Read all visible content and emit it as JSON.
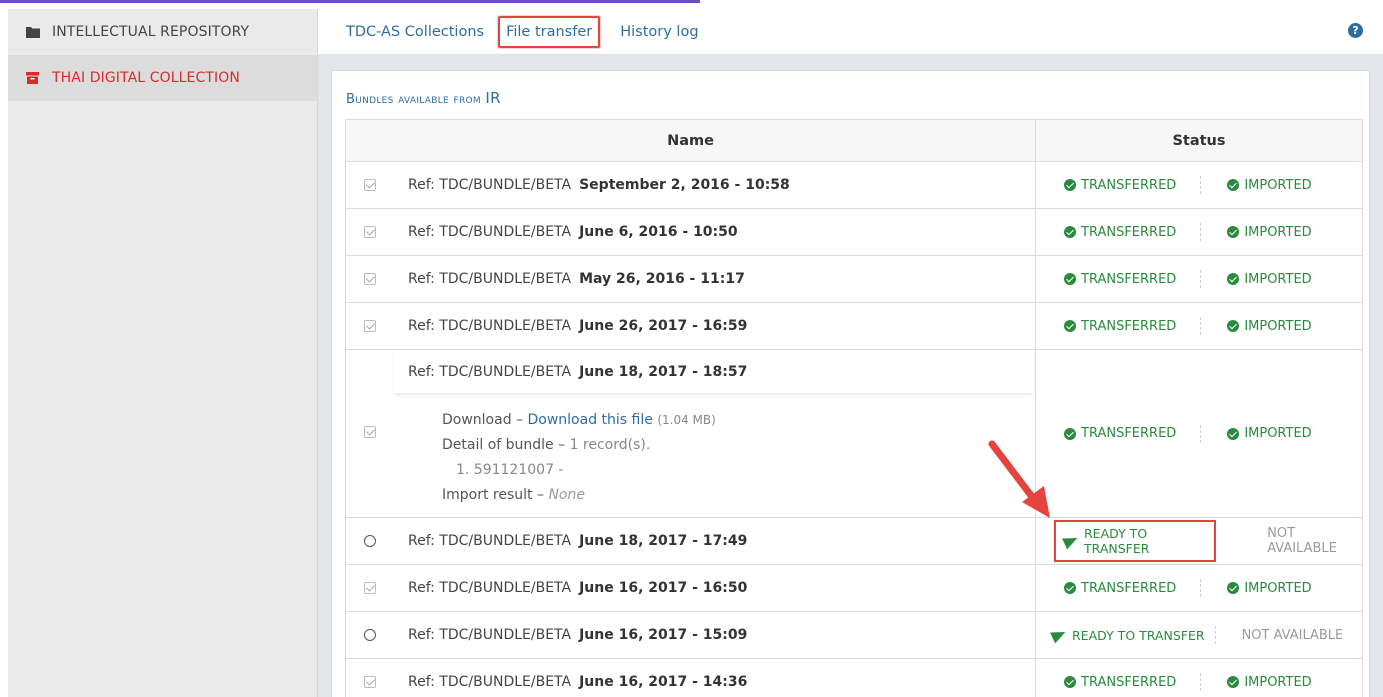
{
  "sidebar": {
    "items": [
      {
        "label": "INTELLECTUAL REPOSITORY",
        "icon": "folder-icon",
        "active": false
      },
      {
        "label": "THAI DIGITAL COLLECTION",
        "icon": "archive-icon",
        "active": true
      }
    ]
  },
  "tabs": [
    {
      "label": "TDC-AS Collections",
      "active": false
    },
    {
      "label": "File transfer",
      "active": true
    },
    {
      "label": "History log",
      "active": false
    }
  ],
  "help_icon": "?",
  "panel": {
    "title_small": "Bundles available from",
    "title_big": "IR"
  },
  "table": {
    "headers": {
      "name": "Name",
      "status": "Status"
    },
    "ref_prefix": "Ref: TDC/BUNDLE/BETA",
    "rows": [
      {
        "selector": "checked",
        "date": "September 2, 2016 - 10:58",
        "status1": "TRANSFERRED",
        "status2": "IMPORTED"
      },
      {
        "selector": "checked",
        "date": "June 6, 2016 - 10:50",
        "status1": "TRANSFERRED",
        "status2": "IMPORTED"
      },
      {
        "selector": "checked",
        "date": "May 26, 2016 - 11:17",
        "status1": "TRANSFERRED",
        "status2": "IMPORTED"
      },
      {
        "selector": "checked",
        "date": "June 26, 2017 - 16:59",
        "status1": "TRANSFERRED",
        "status2": "IMPORTED"
      },
      {
        "selector": "checked",
        "date": "June 18, 2017 - 18:57",
        "status1": "TRANSFERRED",
        "status2": "IMPORTED",
        "expanded": true
      },
      {
        "selector": "radio",
        "date": "June 18, 2017 - 17:49",
        "status1": "READY TO TRANSFER",
        "status2": "NOT AVAILABLE"
      },
      {
        "selector": "checked",
        "date": "June 16, 2017 - 16:50",
        "status1": "TRANSFERRED",
        "status2": "IMPORTED"
      },
      {
        "selector": "radio",
        "date": "June 16, 2017 - 15:09",
        "status1": "READY TO TRANSFER",
        "status2": "NOT AVAILABLE"
      },
      {
        "selector": "checked",
        "date": "June 16, 2017 - 14:36",
        "status1": "TRANSFERRED",
        "status2": "IMPORTED"
      }
    ],
    "expanded_detail": {
      "download_label": "Download –",
      "download_link": "Download this file",
      "download_size": "(1.04 MB)",
      "detail_label": "Detail of bundle –",
      "detail_count": "1 record(s).",
      "record": "1. 591121007 -",
      "import_label": "Import result –",
      "import_value": "None"
    }
  },
  "colors": {
    "accent_red": "#e5443e",
    "link_blue": "#2e6da4",
    "success_green": "#2a8a3e",
    "sidebar_active_red": "#d62b2b"
  }
}
